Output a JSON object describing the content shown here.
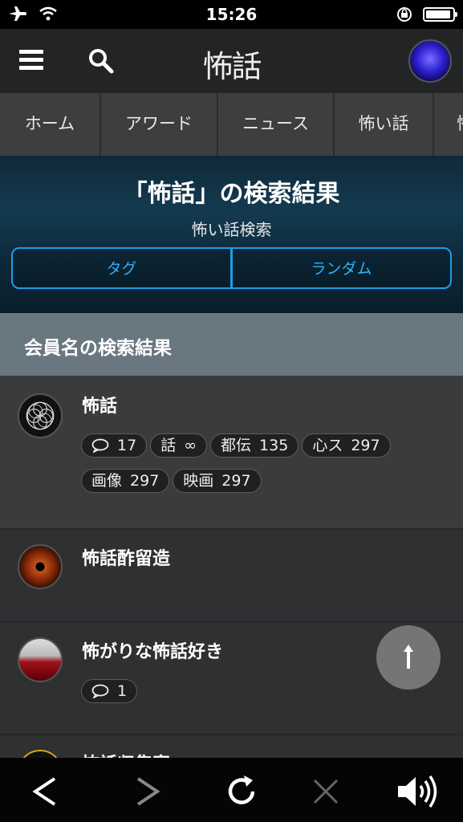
{
  "status": {
    "time": "15:26"
  },
  "header": {
    "logo": "怖話"
  },
  "tabs": [
    "ホーム",
    "アワード",
    "ニュース",
    "怖い話",
    "怖"
  ],
  "hero": {
    "title": "「怖話」の検索結果",
    "subtitle": "怖い話検索",
    "btn_tag": "タグ",
    "btn_random": "ランダム"
  },
  "section": {
    "title": "会員名の検索結果"
  },
  "members": [
    {
      "name": "怖話",
      "badges": [
        {
          "label": "",
          "icon": "speech-bubble-icon",
          "value": "17"
        },
        {
          "label": "話",
          "value": "∞"
        },
        {
          "label": "都伝",
          "value": "135"
        },
        {
          "label": "心ス",
          "value": "297"
        },
        {
          "label": "画像",
          "value": "297"
        },
        {
          "label": "映画",
          "value": "297"
        }
      ]
    },
    {
      "name": "怖話酢留造",
      "badges": []
    },
    {
      "name": "怖がりな怖話好き",
      "badges": [
        {
          "label": "",
          "icon": "speech-bubble-icon",
          "value": "1"
        }
      ]
    },
    {
      "name": "怖話収集家",
      "badges": []
    }
  ],
  "colors": {
    "accent": "#1c9ee6",
    "section_bg": "#697781",
    "header_bg": "#232425"
  }
}
